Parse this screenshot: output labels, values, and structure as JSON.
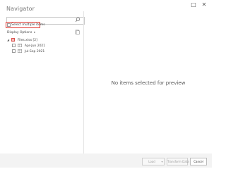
{
  "window": {
    "title": "Navigator",
    "restore_glyph": "□",
    "close_glyph": "✕"
  },
  "search": {
    "placeholder": "",
    "value": ""
  },
  "select_multiple": {
    "label": "Select multiple items",
    "checked": false
  },
  "display_options": {
    "label": "Display Options",
    "arrow": "▾"
  },
  "tree": {
    "root": {
      "label": "Files.xlsx [2]",
      "expander": "◢",
      "icon": "excel-file-icon"
    },
    "items": [
      {
        "label": "Apr-Jun 2021",
        "icon": "sheet-icon",
        "checked": false
      },
      {
        "label": "Jul-Sep 2021",
        "icon": "sheet-icon",
        "checked": false
      }
    ]
  },
  "preview": {
    "empty_message": "No items selected for preview"
  },
  "footer": {
    "load_label": "Load",
    "load_dropdown_glyph": "▾",
    "transform_label": "Transform Data",
    "cancel_label": "Cancel"
  },
  "colors": {
    "highlight_border": "#e0312a",
    "excel_icon": "#d9534f"
  }
}
